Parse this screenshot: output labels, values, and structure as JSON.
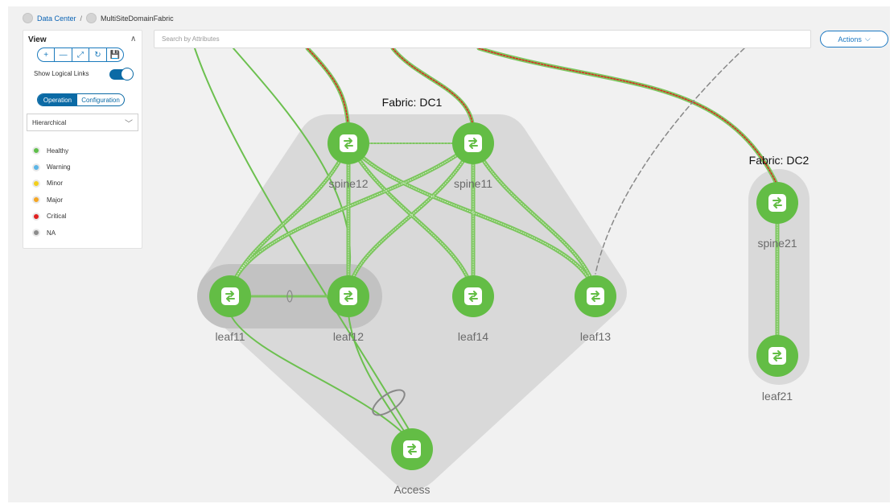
{
  "breadcrumb": {
    "root": "Data Center",
    "separator": "/",
    "current": "MultiSiteDomainFabric"
  },
  "view_panel": {
    "title": "View",
    "toolbar": [
      "+",
      "—",
      "⤢",
      "↻",
      "💾"
    ],
    "show_logical_links_label": "Show Logical Links",
    "show_logical_links_on": true,
    "mode_operation": "Operation",
    "mode_configuration": "Configuration",
    "layout_select": "Hierarchical",
    "legend": [
      {
        "label": "Healthy",
        "color": "#5fbf4a"
      },
      {
        "label": "Warning",
        "color": "#5bb5e6"
      },
      {
        "label": "Minor",
        "color": "#f2cf1d"
      },
      {
        "label": "Major",
        "color": "#f5a623"
      },
      {
        "label": "Critical",
        "color": "#e02020"
      },
      {
        "label": "NA",
        "color": "#8c8c8c"
      }
    ]
  },
  "search": {
    "placeholder": "Search by Attributes"
  },
  "actions": {
    "label": "Actions"
  },
  "colors": {
    "healthy": "#63bd45",
    "link": "#7dc65f",
    "critical": "#e02020",
    "hull": "#d8d8d8",
    "accent": "#0b6aa5"
  },
  "topology": {
    "fabrics": [
      {
        "label": "Fabric: DC1"
      },
      {
        "label": "Fabric: DC2"
      }
    ],
    "nodes": [
      {
        "label": "spine12",
        "icon": "switch-icon"
      },
      {
        "label": "spine11",
        "icon": "switch-icon"
      },
      {
        "label": "leaf11",
        "icon": "switch-icon"
      },
      {
        "label": "leaf12",
        "icon": "switch-icon"
      },
      {
        "label": "leaf14",
        "icon": "switch-icon"
      },
      {
        "label": "leaf13",
        "icon": "switch-icon"
      },
      {
        "label": "spine21",
        "icon": "switch-icon"
      },
      {
        "label": "leaf21",
        "icon": "switch-icon"
      },
      {
        "label": "Access",
        "icon": "switch-icon"
      }
    ]
  }
}
